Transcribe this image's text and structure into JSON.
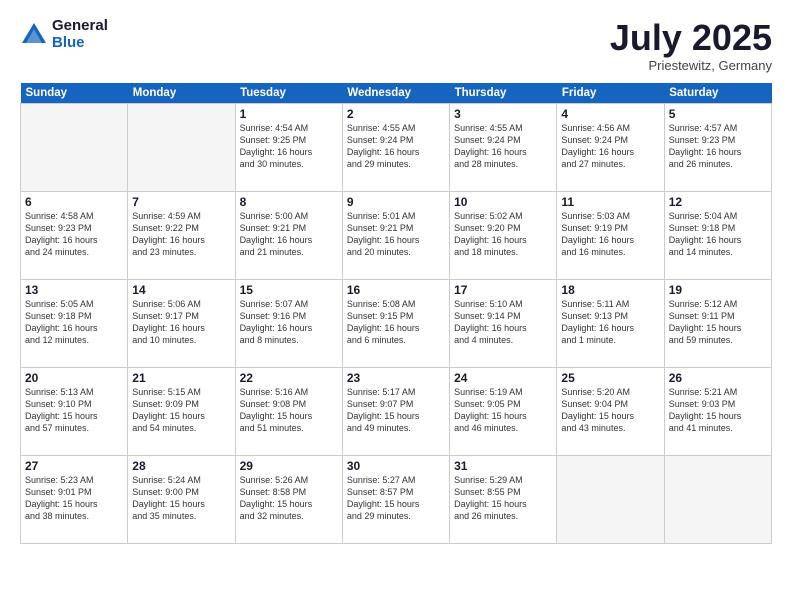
{
  "logo": {
    "general": "General",
    "blue": "Blue"
  },
  "title": "July 2025",
  "location": "Priestewitz, Germany",
  "days_of_week": [
    "Sunday",
    "Monday",
    "Tuesday",
    "Wednesday",
    "Thursday",
    "Friday",
    "Saturday"
  ],
  "weeks": [
    [
      {
        "day": "",
        "info": ""
      },
      {
        "day": "",
        "info": ""
      },
      {
        "day": "1",
        "info": "Sunrise: 4:54 AM\nSunset: 9:25 PM\nDaylight: 16 hours\nand 30 minutes."
      },
      {
        "day": "2",
        "info": "Sunrise: 4:55 AM\nSunset: 9:24 PM\nDaylight: 16 hours\nand 29 minutes."
      },
      {
        "day": "3",
        "info": "Sunrise: 4:55 AM\nSunset: 9:24 PM\nDaylight: 16 hours\nand 28 minutes."
      },
      {
        "day": "4",
        "info": "Sunrise: 4:56 AM\nSunset: 9:24 PM\nDaylight: 16 hours\nand 27 minutes."
      },
      {
        "day": "5",
        "info": "Sunrise: 4:57 AM\nSunset: 9:23 PM\nDaylight: 16 hours\nand 26 minutes."
      }
    ],
    [
      {
        "day": "6",
        "info": "Sunrise: 4:58 AM\nSunset: 9:23 PM\nDaylight: 16 hours\nand 24 minutes."
      },
      {
        "day": "7",
        "info": "Sunrise: 4:59 AM\nSunset: 9:22 PM\nDaylight: 16 hours\nand 23 minutes."
      },
      {
        "day": "8",
        "info": "Sunrise: 5:00 AM\nSunset: 9:21 PM\nDaylight: 16 hours\nand 21 minutes."
      },
      {
        "day": "9",
        "info": "Sunrise: 5:01 AM\nSunset: 9:21 PM\nDaylight: 16 hours\nand 20 minutes."
      },
      {
        "day": "10",
        "info": "Sunrise: 5:02 AM\nSunset: 9:20 PM\nDaylight: 16 hours\nand 18 minutes."
      },
      {
        "day": "11",
        "info": "Sunrise: 5:03 AM\nSunset: 9:19 PM\nDaylight: 16 hours\nand 16 minutes."
      },
      {
        "day": "12",
        "info": "Sunrise: 5:04 AM\nSunset: 9:18 PM\nDaylight: 16 hours\nand 14 minutes."
      }
    ],
    [
      {
        "day": "13",
        "info": "Sunrise: 5:05 AM\nSunset: 9:18 PM\nDaylight: 16 hours\nand 12 minutes."
      },
      {
        "day": "14",
        "info": "Sunrise: 5:06 AM\nSunset: 9:17 PM\nDaylight: 16 hours\nand 10 minutes."
      },
      {
        "day": "15",
        "info": "Sunrise: 5:07 AM\nSunset: 9:16 PM\nDaylight: 16 hours\nand 8 minutes."
      },
      {
        "day": "16",
        "info": "Sunrise: 5:08 AM\nSunset: 9:15 PM\nDaylight: 16 hours\nand 6 minutes."
      },
      {
        "day": "17",
        "info": "Sunrise: 5:10 AM\nSunset: 9:14 PM\nDaylight: 16 hours\nand 4 minutes."
      },
      {
        "day": "18",
        "info": "Sunrise: 5:11 AM\nSunset: 9:13 PM\nDaylight: 16 hours\nand 1 minute."
      },
      {
        "day": "19",
        "info": "Sunrise: 5:12 AM\nSunset: 9:11 PM\nDaylight: 15 hours\nand 59 minutes."
      }
    ],
    [
      {
        "day": "20",
        "info": "Sunrise: 5:13 AM\nSunset: 9:10 PM\nDaylight: 15 hours\nand 57 minutes."
      },
      {
        "day": "21",
        "info": "Sunrise: 5:15 AM\nSunset: 9:09 PM\nDaylight: 15 hours\nand 54 minutes."
      },
      {
        "day": "22",
        "info": "Sunrise: 5:16 AM\nSunset: 9:08 PM\nDaylight: 15 hours\nand 51 minutes."
      },
      {
        "day": "23",
        "info": "Sunrise: 5:17 AM\nSunset: 9:07 PM\nDaylight: 15 hours\nand 49 minutes."
      },
      {
        "day": "24",
        "info": "Sunrise: 5:19 AM\nSunset: 9:05 PM\nDaylight: 15 hours\nand 46 minutes."
      },
      {
        "day": "25",
        "info": "Sunrise: 5:20 AM\nSunset: 9:04 PM\nDaylight: 15 hours\nand 43 minutes."
      },
      {
        "day": "26",
        "info": "Sunrise: 5:21 AM\nSunset: 9:03 PM\nDaylight: 15 hours\nand 41 minutes."
      }
    ],
    [
      {
        "day": "27",
        "info": "Sunrise: 5:23 AM\nSunset: 9:01 PM\nDaylight: 15 hours\nand 38 minutes."
      },
      {
        "day": "28",
        "info": "Sunrise: 5:24 AM\nSunset: 9:00 PM\nDaylight: 15 hours\nand 35 minutes."
      },
      {
        "day": "29",
        "info": "Sunrise: 5:26 AM\nSunset: 8:58 PM\nDaylight: 15 hours\nand 32 minutes."
      },
      {
        "day": "30",
        "info": "Sunrise: 5:27 AM\nSunset: 8:57 PM\nDaylight: 15 hours\nand 29 minutes."
      },
      {
        "day": "31",
        "info": "Sunrise: 5:29 AM\nSunset: 8:55 PM\nDaylight: 15 hours\nand 26 minutes."
      },
      {
        "day": "",
        "info": ""
      },
      {
        "day": "",
        "info": ""
      }
    ]
  ]
}
